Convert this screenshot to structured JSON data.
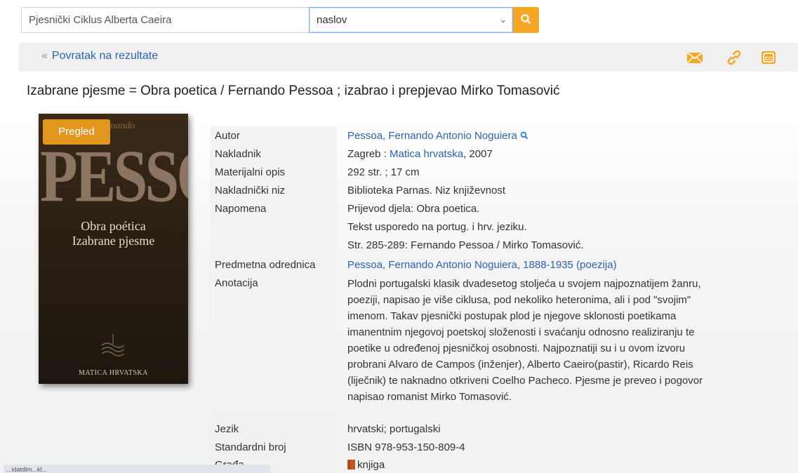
{
  "search": {
    "query": "Pjesnički Ciklus Alberta Caeira",
    "field_selected": "naslov",
    "button_icon": "search-icon"
  },
  "nav": {
    "back_label": "Povratak na rezultate",
    "back_icon": "double-chevron-left-icon",
    "tools": [
      "email-icon",
      "link-icon",
      "cite-icon"
    ],
    "tool_color": "#f5a623"
  },
  "record": {
    "title": "Izabrane pjesme = Obra poetica / Fernando Pessoa ; izabrao i prepjevao Mirko Tomasović",
    "cover": {
      "preview_label": "Pregled",
      "author_small": "Fernando",
      "author_big": "PESSOA",
      "subtitle_1": "Obra poética",
      "subtitle_2": "Izabrane pjesme",
      "publisher": "MATICA HRVATSKA"
    },
    "fields": {
      "author_label": "Autor",
      "author_value": "Pessoa, Fernando Antonio Noguiera",
      "publisher_label": "Nakladnik",
      "publisher_place": "Zagreb : ",
      "publisher_name": "Matica hrvatska",
      "publisher_year": ", 2007",
      "physical_label": "Materijalni opis",
      "physical_value": "292 str. ; 17 cm",
      "series_label": "Nakladnički niz",
      "series_value": "Biblioteka Parnas. Niz književnost",
      "note_label": "Napomena",
      "note_values": [
        "Prijevod djela: Obra poetica.",
        "Tekst usporedo na portug. i hrv. jeziku.",
        "Str. 285-289: Fernando Pessoa / Mirko Tomasović."
      ],
      "subject_label": "Predmetna odrednica",
      "subject_value": "Pessoa, Fernando Antonio Noguiera, 1888-1935 (poezija)",
      "annotation_label": "Anotacija",
      "annotation_value": "Plodni portugalski klasik dvadesetog stoljeća u svojem najpoznatijem žanru, poeziji, napisao je više ciklusa, pod nekoliko heteronima, ali i pod \"svojim\" imenom. Takav pjesnički postupak plod je njegove sklonosti poetikama imanentnim njegovoj poetskoj složenosti i svaćanju odnosno realiziranju te poetike u određenoj pjesničkoj osobnosti. Najpoznatiji su i u ovom izvoru probrani Alvaro de Campos (inženjer), Alberto Caeiro(pastir), Ricardo Reis (liječnik) te naknadno otkriveni Coelho Pacheco. Pjesme je preveo i pogovor napisao romanist Mirko Tomasović.",
      "language_label": "Jezik",
      "language_value": "hrvatski; portugalski",
      "isbn_label": "Standardni broj",
      "isbn_value": "ISBN 978-953-150-809-4",
      "material_label": "Građa",
      "material_value": "knjiga",
      "material_icon": "book-icon"
    }
  },
  "status_bar_text": "...idatdlm...kl..."
}
